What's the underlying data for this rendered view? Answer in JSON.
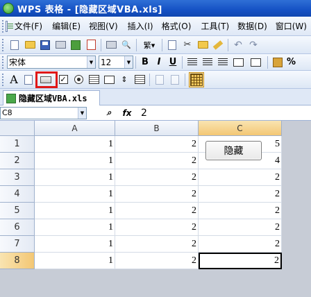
{
  "title": "WPS 表格 - [隐藏区域VBA.xls]",
  "menu": [
    "文件(F)",
    "编辑(E)",
    "视图(V)",
    "插入(I)",
    "格式(O)",
    "工具(T)",
    "数据(D)",
    "窗口(W)"
  ],
  "toolbar": {
    "font_name": "宋体",
    "font_size": "12",
    "bold": "B",
    "italic": "I",
    "underline": "U",
    "percent": "%"
  },
  "document_tab": "隐藏区域VBA.xls",
  "formula_bar": {
    "name_box": "C8",
    "fx_label": "fx",
    "value": "2"
  },
  "sheet": {
    "columns": [
      "A",
      "B",
      "C"
    ],
    "rows": [
      {
        "row": "1",
        "a": "1",
        "b": "2",
        "c": "5"
      },
      {
        "row": "2",
        "a": "1",
        "b": "2",
        "c": "4"
      },
      {
        "row": "3",
        "a": "1",
        "b": "2",
        "c": "2"
      },
      {
        "row": "4",
        "a": "1",
        "b": "2",
        "c": "2"
      },
      {
        "row": "5",
        "a": "1",
        "b": "2",
        "c": "2"
      },
      {
        "row": "6",
        "a": "1",
        "b": "2",
        "c": "2"
      },
      {
        "row": "7",
        "a": "1",
        "b": "2",
        "c": "2"
      },
      {
        "row": "8",
        "a": "1",
        "b": "2",
        "c": "2"
      }
    ],
    "active_cell": "C8"
  },
  "form_button_label": "隐藏",
  "colors": {
    "titlebar": "#1551c4",
    "highlight_box": "#e01818",
    "selected_header": "#f3c774"
  }
}
